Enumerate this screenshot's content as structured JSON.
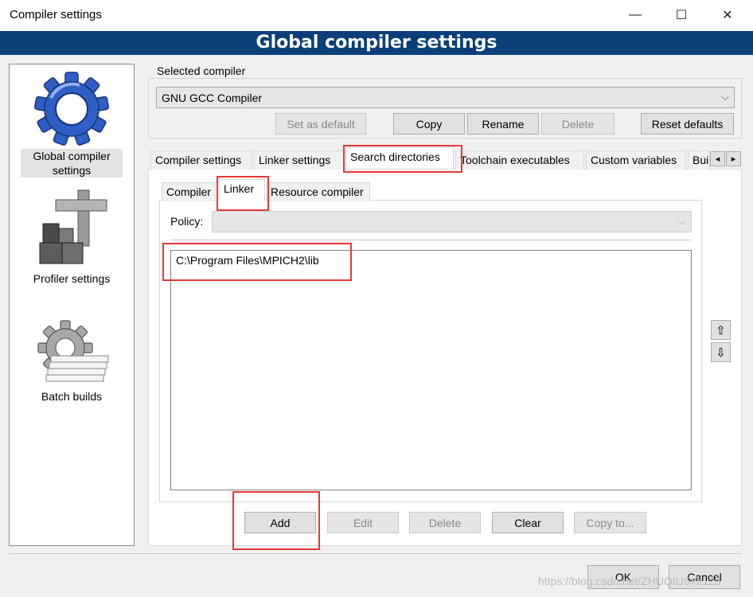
{
  "window": {
    "title": "Compiler settings",
    "minimize": "—",
    "maximize": "☐",
    "close": "✕"
  },
  "header": {
    "banner": "Global compiler settings"
  },
  "sidebar": {
    "items": [
      {
        "label": "Global compiler settings",
        "icon": "gear-icon"
      },
      {
        "label": "Profiler settings",
        "icon": "caliper-icon"
      },
      {
        "label": "Batch builds",
        "icon": "batch-gear-icon"
      }
    ]
  },
  "compiler": {
    "group_label": "Selected compiler",
    "selected": "GNU GCC Compiler",
    "buttons": {
      "set_default": "Set as default",
      "copy": "Copy",
      "rename": "Rename",
      "delete": "Delete",
      "reset": "Reset defaults"
    }
  },
  "tabs": [
    "Compiler settings",
    "Linker settings",
    "Search directories",
    "Toolchain executables",
    "Custom variables",
    "Bui"
  ],
  "active_tab": "Search directories",
  "subtabs": [
    "Compiler",
    "Linker",
    "Resource compiler"
  ],
  "active_subtab": "Linker",
  "search_dirs": {
    "policy_label": "Policy:",
    "policy_value": "",
    "directories": [
      "C:\\Program Files\\MPICH2\\lib"
    ],
    "move_up": "⇧",
    "move_down": "⇩",
    "buttons": {
      "add": "Add",
      "edit": "Edit",
      "delete": "Delete",
      "clear": "Clear",
      "copy_to": "Copy to..."
    }
  },
  "dialog": {
    "ok": "OK",
    "cancel": "Cancel"
  },
  "scroll": {
    "left": "◂",
    "right": "▸"
  },
  "watermark": "https://blog.csdn.net/ZHUQIUSHI123",
  "colors": {
    "banner": "#0a3f7a",
    "highlight": "#e53935"
  }
}
